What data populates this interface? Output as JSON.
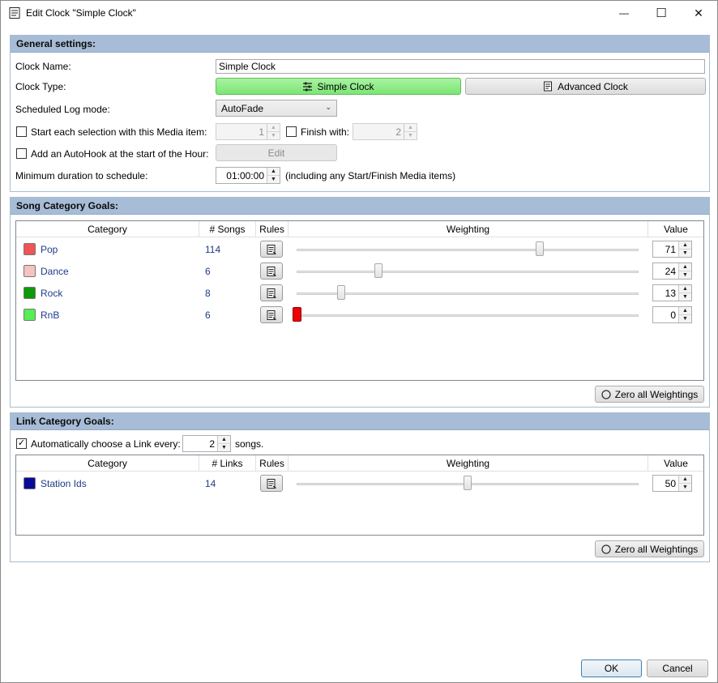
{
  "window": {
    "title": "Edit Clock \"Simple Clock\"",
    "controls": {
      "minimize": "—",
      "maximize": "☐",
      "close": "✕"
    }
  },
  "general": {
    "header": "General settings:",
    "clock_name_label": "Clock Name:",
    "clock_name_value": "Simple Clock",
    "clock_type_label": "Clock Type:",
    "simple_clock_label": "Simple Clock",
    "advanced_clock_label": "Advanced Clock",
    "log_mode_label": "Scheduled Log mode:",
    "log_mode_value": "AutoFade",
    "start_media_label": "Start each selection with this Media item:",
    "start_media_value": "1",
    "finish_label": "Finish with:",
    "finish_value": "2",
    "autohook_label": "Add an AutoHook at the start of the Hour:",
    "edit_label": "Edit",
    "min_duration_label": "Minimum duration to schedule:",
    "min_duration_value": "01:00:00",
    "min_duration_note": "(including any Start/Finish Media items)"
  },
  "song_goals": {
    "header": "Song Category Goals:",
    "columns": {
      "category": "Category",
      "count": "# Songs",
      "rules": "Rules",
      "weighting": "Weighting",
      "value": "Value"
    },
    "rows": [
      {
        "name": "Pop",
        "count": "114",
        "value": "71",
        "weight": 71,
        "color": "#f05555"
      },
      {
        "name": "Dance",
        "count": "6",
        "value": "24",
        "weight": 24,
        "color": "#f7c2c2"
      },
      {
        "name": "Rock",
        "count": "8",
        "value": "13",
        "weight": 13,
        "color": "#0a9a0a"
      },
      {
        "name": "RnB",
        "count": "6",
        "value": "0",
        "weight": 0,
        "color": "#55ee55"
      }
    ],
    "zero_label": "Zero all Weightings"
  },
  "link_goals": {
    "header": "Link Category Goals:",
    "auto_label": "Automatically choose a Link every:",
    "auto_value": "2",
    "auto_suffix": "songs.",
    "columns": {
      "category": "Category",
      "count": "# Links",
      "rules": "Rules",
      "weighting": "Weighting",
      "value": "Value"
    },
    "rows": [
      {
        "name": "Station Ids",
        "count": "14",
        "value": "50",
        "weight": 50,
        "color": "#0a0a9a"
      }
    ],
    "zero_label": "Zero all Weightings"
  },
  "footer": {
    "ok_label": "OK",
    "cancel_label": "Cancel"
  }
}
